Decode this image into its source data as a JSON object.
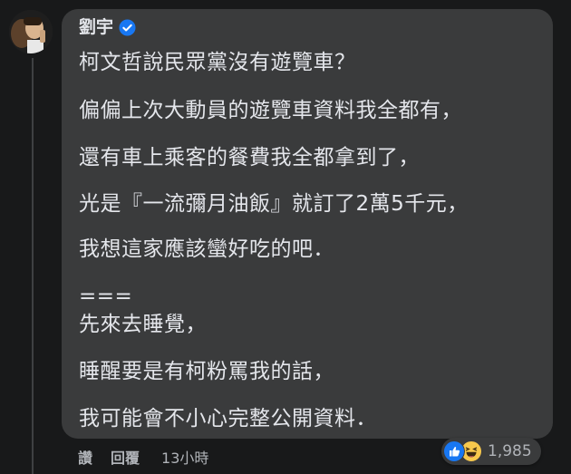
{
  "comment": {
    "author": "劉宇",
    "verified_icon": "verified-badge-icon",
    "lines": [
      "柯文哲說民眾黨沒有遊覽車？",
      "偏偏上次大動員的遊覽車資料我全都有，",
      "還有車上乘客的餐費我全都拿到了，",
      "光是『一流彌月油飯』就訂了2萬5千元，",
      "我想這家應該蠻好吃的吧．",
      "===",
      "先來去睡覺，",
      "睡醒要是有柯粉罵我的話，",
      "我可能會不小心完整公開資料．"
    ]
  },
  "actions": {
    "like": "讚",
    "reply": "回覆",
    "time": "13小時"
  },
  "reactions": {
    "icons": [
      "like-icon",
      "haha-icon"
    ],
    "count": "1,985"
  },
  "colors": {
    "background": "#18191a",
    "bubble": "#3a3b3c",
    "text": "#e4e6eb",
    "muted": "#b0b3b8",
    "accent": "#1877f2"
  }
}
